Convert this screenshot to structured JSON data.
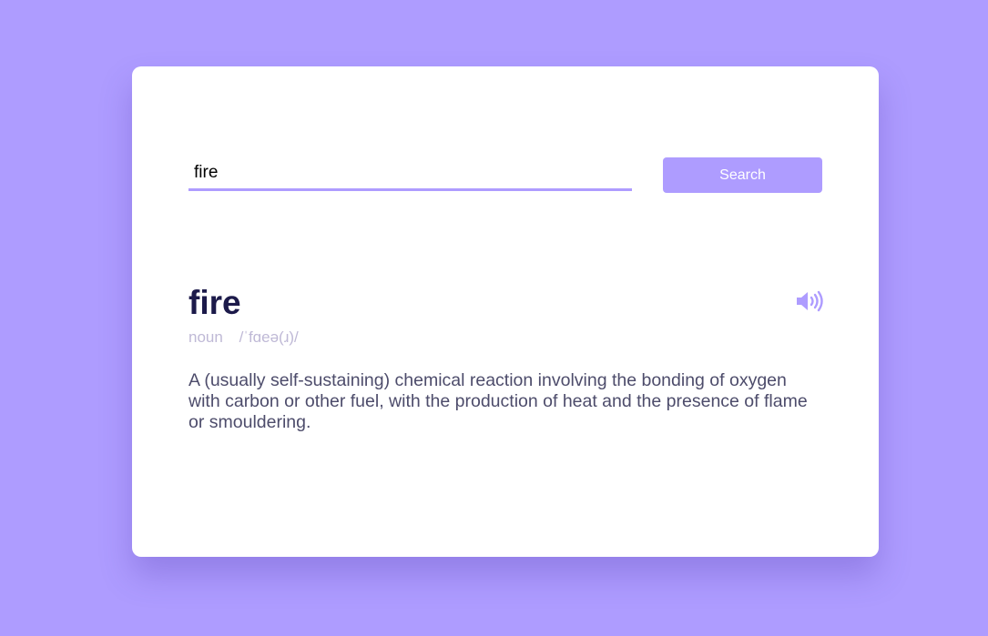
{
  "colors": {
    "background": "#ae9cff",
    "accent": "#ae9cff",
    "card": "#ffffff",
    "word": "#1c1a4a",
    "muted": "#bfb9d6",
    "text": "#4d4c6b"
  },
  "search": {
    "value": "fire",
    "button_label": "Search"
  },
  "result": {
    "word": "fire",
    "part_of_speech": "noun",
    "phonetic": "/ˈfɑeə(ɹ)/",
    "definition": "A (usually self-sustaining) chemical reaction involving the bonding of oxygen with carbon or other fuel, with the production of heat and the presence of flame or smouldering.",
    "sound_icon": "speaker-volume-icon"
  }
}
